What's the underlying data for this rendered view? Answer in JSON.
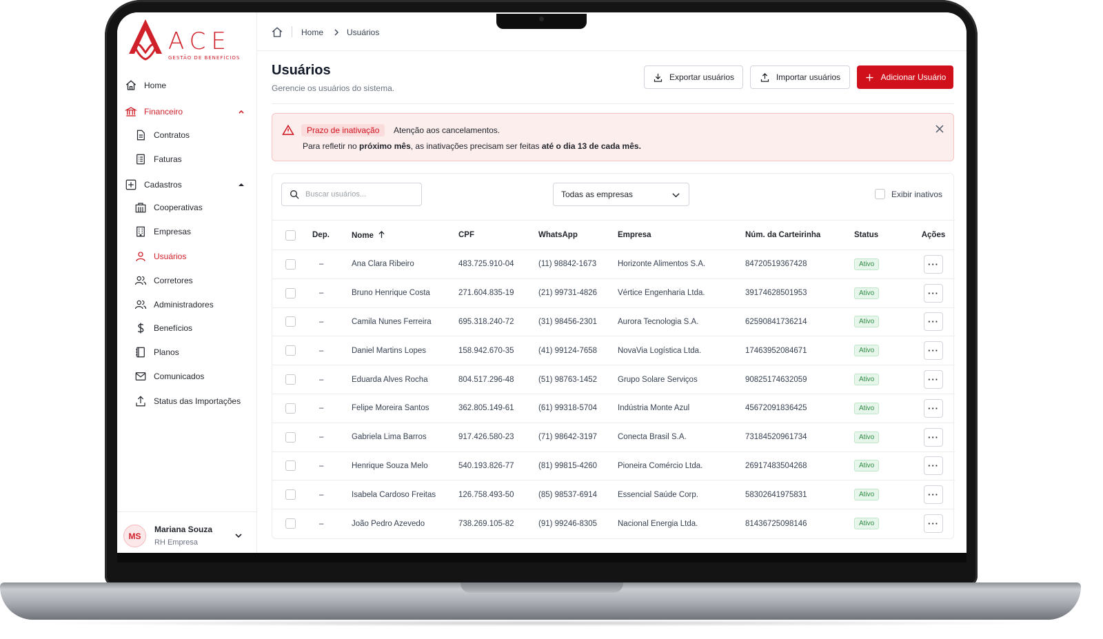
{
  "brand": {
    "name": "ACE",
    "tagline": "GESTÃO DE BENEFÍCIOS",
    "color": "#d0202a"
  },
  "sidebar": {
    "items": [
      {
        "label": "Home",
        "icon": "home-icon"
      },
      {
        "label": "Financeiro",
        "icon": "bank-icon",
        "expanded": true
      },
      {
        "label": "Contratos",
        "icon": "document-icon"
      },
      {
        "label": "Faturas",
        "icon": "invoice-icon"
      },
      {
        "label": "Cadastros",
        "icon": "plus-square-icon",
        "expanded": true
      },
      {
        "label": "Cooperativas",
        "icon": "building-icon"
      },
      {
        "label": "Empresas",
        "icon": "office-icon"
      },
      {
        "label": "Usuários",
        "icon": "user-icon",
        "active": true
      },
      {
        "label": "Corretores",
        "icon": "users-icon"
      },
      {
        "label": "Administradores",
        "icon": "admin-users-icon"
      },
      {
        "label": "Benefícios",
        "icon": "dollar-icon"
      },
      {
        "label": "Planos",
        "icon": "book-icon"
      },
      {
        "label": "Comunicados",
        "icon": "mail-icon"
      },
      {
        "label": "Status das Importações",
        "icon": "upload-icon"
      }
    ],
    "user": {
      "initials": "MS",
      "name": "Mariana Souza",
      "role": "RH Empresa"
    }
  },
  "breadcrumb": {
    "home": "Home",
    "current": "Usuários"
  },
  "page": {
    "title": "Usuários",
    "subtitle": "Gerencie os usuários do sistema."
  },
  "actions": {
    "export": "Exportar usuários",
    "import": "Importar usuários",
    "add": "Adicionar Usuário"
  },
  "alert": {
    "tag": "Prazo de inativação",
    "title": "Atenção aos cancelamentos.",
    "text_1": "Para refletir no ",
    "text_2": "próximo mês",
    "text_3": ", as inativações precisam ser feitas ",
    "text_4": "até o dia 13 de cada mês."
  },
  "filters": {
    "search_placeholder": "Buscar usuários...",
    "company_select": "Todas as empresas",
    "show_inactive": "Exibir inativos"
  },
  "table": {
    "columns": {
      "dep": "Dep.",
      "name": "Nome",
      "cpf": "CPF",
      "whatsapp": "WhatsApp",
      "company": "Empresa",
      "card": "Núm. da Carteirinha",
      "status": "Status",
      "actions": "Ações"
    },
    "rows": [
      {
        "dep": "–",
        "name": "Ana Clara Ribeiro",
        "cpf": "483.725.910-04",
        "whatsapp": "(11) 98842-1673",
        "company": "Horizonte Alimentos S.A.",
        "card": "84720519367428",
        "status": "Ativo"
      },
      {
        "dep": "–",
        "name": "Bruno Henrique Costa",
        "cpf": "271.604.835-19",
        "whatsapp": "(21) 99731-4826",
        "company": "Vértice Engenharia Ltda.",
        "card": "39174628501953",
        "status": "Ativo"
      },
      {
        "dep": "–",
        "name": "Camila Nunes Ferreira",
        "cpf": "695.318.240-72",
        "whatsapp": "(31) 98456-2301",
        "company": "Aurora Tecnologia S.A.",
        "card": "62590841736214",
        "status": "Ativo"
      },
      {
        "dep": "–",
        "name": "Daniel Martins Lopes",
        "cpf": "158.942.670-35",
        "whatsapp": "(41) 99124-7658",
        "company": "NovaVia Logística Ltda.",
        "card": "17463952084671",
        "status": "Ativo"
      },
      {
        "dep": "–",
        "name": "Eduarda Alves Rocha",
        "cpf": "804.517.296-48",
        "whatsapp": "(51) 98763-1452",
        "company": "Grupo Solare Serviços",
        "card": "90825174632059",
        "status": "Ativo"
      },
      {
        "dep": "–",
        "name": "Felipe Moreira Santos",
        "cpf": "362.805.149-61",
        "whatsapp": "(61) 99318-5704",
        "company": "Indústria Monte Azul",
        "card": "45672091836425",
        "status": "Ativo"
      },
      {
        "dep": "–",
        "name": "Gabriela Lima Barros",
        "cpf": "917.426.580-23",
        "whatsapp": "(71) 98642-3197",
        "company": "Conecta Brasil S.A.",
        "card": "73184520961734",
        "status": "Ativo"
      },
      {
        "dep": "–",
        "name": "Henrique Souza Melo",
        "cpf": "540.193.826-77",
        "whatsapp": "(81) 99815-4260",
        "company": "Pioneira Comércio Ltda.",
        "card": "26917483504268",
        "status": "Ativo"
      },
      {
        "dep": "–",
        "name": "Isabela Cardoso Freitas",
        "cpf": "126.758.493-50",
        "whatsapp": "(85) 98537-6914",
        "company": "Essencial Saúde Corp.",
        "card": "58302641975831",
        "status": "Ativo"
      },
      {
        "dep": "–",
        "name": "João Pedro Azevedo",
        "cpf": "738.269.105-82",
        "whatsapp": "(91) 99246-8305",
        "company": "Nacional Energia Ltda.",
        "card": "81436725098146",
        "status": "Ativo"
      }
    ],
    "row_action_label": "···"
  },
  "colors": {
    "accent": "#d0101b",
    "alert_bg": "#fdeeee",
    "status_active": "#2e8b45"
  }
}
